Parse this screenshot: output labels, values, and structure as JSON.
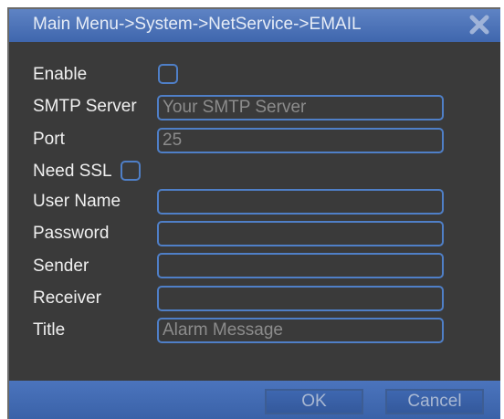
{
  "window": {
    "title": "Main Menu->System->NetService->EMAIL",
    "close_icon": "close-x-icon"
  },
  "form": {
    "enable": {
      "label": "Enable",
      "checked": false
    },
    "smtp_server": {
      "label": "SMTP Server",
      "value": "",
      "placeholder": "Your SMTP Server"
    },
    "port": {
      "label": "Port",
      "value": "25"
    },
    "need_ssl": {
      "label": "Need SSL",
      "checked": false
    },
    "user_name": {
      "label": "User Name",
      "value": ""
    },
    "password": {
      "label": "Password",
      "value": ""
    },
    "sender": {
      "label": "Sender",
      "value": ""
    },
    "receiver": {
      "label": "Receiver",
      "value": ""
    },
    "title": {
      "label": "Title",
      "value": "",
      "placeholder": "Alarm Message"
    }
  },
  "footer": {
    "ok_label": "OK",
    "cancel_label": "Cancel"
  },
  "colors": {
    "accent": "#4f7fc7",
    "titlebar": "#4a70b8",
    "panel": "#3a3a3a"
  }
}
